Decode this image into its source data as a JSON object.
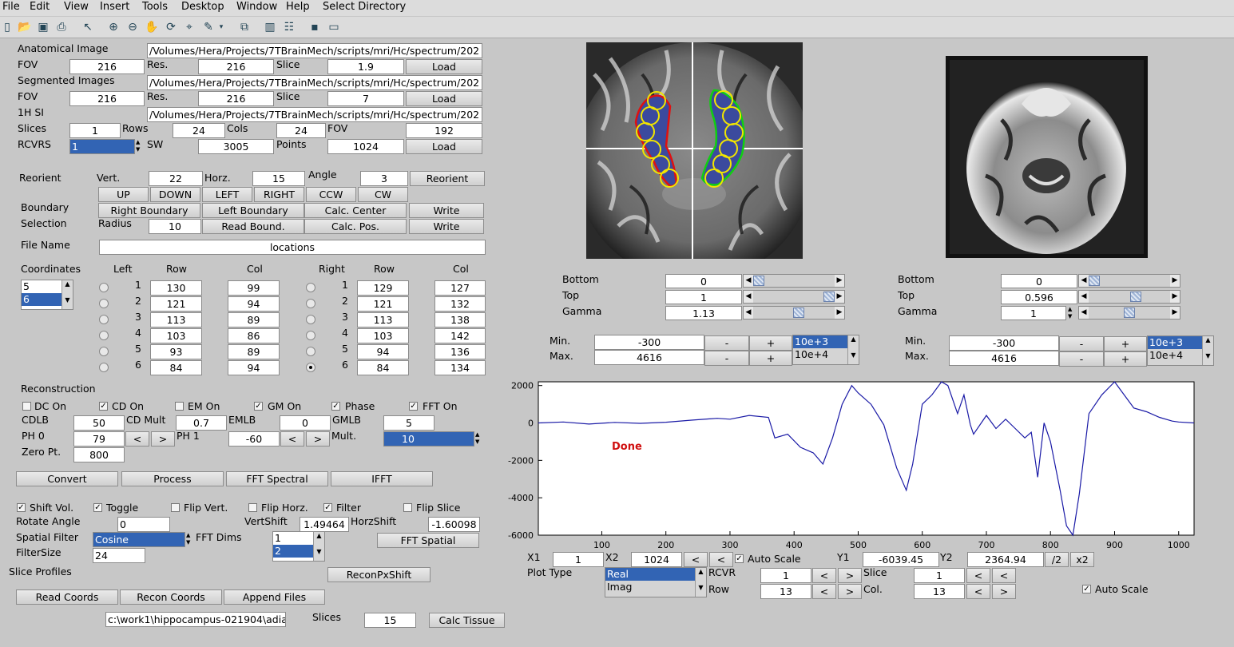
{
  "menu": [
    "File",
    "Edit",
    "View",
    "Insert",
    "Tools",
    "Desktop",
    "Window",
    "Help",
    "Select Directory"
  ],
  "toolbar_icons": [
    "new-file-icon",
    "open-folder-icon",
    "save-icon",
    "print-icon",
    "pointer-icon",
    "zoom-in-icon",
    "zoom-out-icon",
    "pan-hand-icon",
    "rotate-icon",
    "data-cursor-icon",
    "brush-icon",
    "dropdown-icon",
    "link-plot-icon",
    "colorbar-icon",
    "legend-icon",
    "hide-plot-tools-icon",
    "show-plot-tools-icon"
  ],
  "files": {
    "anat_label": "Anatomical Image",
    "anat_path": "/Volumes/Hera/Projects/7TBrainMech/scripts/mri/Hc/spectrum/202",
    "fov_label": "FOV",
    "fov1": "216",
    "res_label": "Res.",
    "res1": "216",
    "slice_label": "Slice",
    "slice1": "1.9",
    "load": "Load",
    "seg_label": "Segmented Images",
    "seg_path": "/Volumes/Hera/Projects/7TBrainMech/scripts/mri/Hc/spectrum/202",
    "fov2": "216",
    "res2": "216",
    "slice2": "7",
    "si_label": "1H SI",
    "si_path": "/Volumes/Hera/Projects/7TBrainMech/scripts/mri/Hc/spectrum/202",
    "slices_label": "Slices",
    "slices": "1",
    "rows_label": "Rows",
    "rows": "24",
    "cols_label": "Cols",
    "cols": "24",
    "fov3": "192",
    "rcvrs_label": "RCVRS",
    "rcvrs": "1",
    "sw_label": "SW",
    "sw": "3005",
    "points_label": "Points",
    "points": "1024"
  },
  "reorient": {
    "label": "Reorient",
    "vert_label": "Vert.",
    "vert": "22",
    "horz_label": "Horz.",
    "horz": "15",
    "angle_label": "Angle",
    "angle": "3",
    "button": "Reorient",
    "up": "UP",
    "down": "DOWN",
    "left": "LEFT",
    "right": "RIGHT",
    "ccw": "CCW",
    "cw": "CW",
    "boundary_label": "Boundary",
    "right_boundary": "Right Boundary",
    "left_boundary": "Left Boundary",
    "calc_center": "Calc. Center",
    "write": "Write",
    "selection_label": "Selection",
    "radius_label": "Radius",
    "radius": "10",
    "read_bound": "Read Bound.",
    "calc_pos": "Calc. Pos.",
    "file_name_label": "File Name",
    "file_name": "locations"
  },
  "coords": {
    "label": "Coordinates",
    "list": [
      "5",
      "6"
    ],
    "left_label": "Left",
    "right_label": "Right",
    "row_label": "Row",
    "col_label": "Col",
    "idx": [
      "1",
      "2",
      "3",
      "4",
      "5",
      "6"
    ],
    "left_rows": [
      "130",
      "121",
      "113",
      "103",
      "93",
      "84"
    ],
    "left_cols": [
      "99",
      "94",
      "89",
      "86",
      "89",
      "94"
    ],
    "right_rows": [
      "129",
      "121",
      "113",
      "103",
      "94",
      "84"
    ],
    "right_cols": [
      "127",
      "132",
      "138",
      "142",
      "136",
      "134"
    ]
  },
  "recon": {
    "label": "Reconstruction",
    "dc": "DC On",
    "cd": "CD On",
    "em": "EM On",
    "gm": "GM On",
    "phase": "Phase",
    "fft": "FFT On",
    "cdlb_label": "CDLB",
    "cdlb": "50",
    "cdmult_label": "CD Mult",
    "cdmult": "0.7",
    "emlb_label": "EMLB",
    "emlb": "0",
    "gmlb_label": "GMLB",
    "gmlb": "5",
    "ph0_label": "PH 0",
    "ph0": "79",
    "ph1_label": "PH 1",
    "ph1": "-60",
    "mult_label": "Mult.",
    "mult": "10",
    "zero_label": "Zero Pt.",
    "zero": "800",
    "lt": "<",
    "gt": ">",
    "convert": "Convert",
    "process": "Process",
    "fft_spectral": "FFT Spectral",
    "ifft": "IFFT"
  },
  "shift": {
    "shift_vol": "Shift Vol.",
    "toggle": "Toggle",
    "flip_vert": "Flip Vert.",
    "flip_horz": "Flip Horz.",
    "filter": "Filter",
    "flip_slice": "Flip Slice",
    "rotate_label": "Rotate Angle",
    "rotate": "0",
    "vshift_label": "VertShift",
    "vshift": "1.49464",
    "hshift_label": "HorzShift",
    "hshift": "-1.60098",
    "spatial_label": "Spatial Filter",
    "spatial": "Cosine",
    "fftdims_label": "FFT Dims",
    "fftdims": [
      "1",
      "2"
    ],
    "fft_spatial": "FFT Spatial",
    "filtersize_label": "FilterSize",
    "filtersize": "24",
    "slice_profiles": "Slice Profiles",
    "recon_px_shift": "ReconPxShift",
    "read_coords": "Read Coords",
    "recon_coords": "Recon Coords",
    "append_files": "Append Files",
    "path": "c:\\work1\\hippocampus-021904\\adia",
    "slices_label": "Slices",
    "slices": "15",
    "calc_tissue": "Calc Tissue"
  },
  "display1": {
    "bottom_label": "Bottom",
    "bottom": "0",
    "top_label": "Top",
    "top": "1",
    "gamma_label": "Gamma",
    "gamma": "1.13",
    "min_label": "Min.",
    "min": "-300",
    "max_label": "Max.",
    "max": "4616",
    "minus": "-",
    "plus": "+",
    "scale_opts": [
      "10e+3",
      "10e+4"
    ],
    "bottom_level": 0.0,
    "top_level": 1.0,
    "gamma_level": 0.57
  },
  "display2": {
    "bottom_label": "Bottom",
    "bottom": "0",
    "top_label": "Top",
    "top": "0.596",
    "gamma_label": "Gamma",
    "gamma": "1",
    "min_label": "Min.",
    "min": "-300",
    "max_label": "Max.",
    "max": "4616",
    "minus": "-",
    "plus": "+",
    "scale_opts": [
      "10e+3",
      "10e+4"
    ],
    "bottom_level": 0.0,
    "top_level": 0.596,
    "gamma_level": 0.5
  },
  "plot": {
    "status": "Done",
    "status_color": "#d01010",
    "line_color": "#1a1aa6",
    "x1_label": "X1",
    "x1": "1",
    "x2_label": "X2",
    "x2": "1024",
    "lt": "<",
    "auto_scale": "Auto Scale",
    "y1_label": "Y1",
    "y1": "-6039.45",
    "y2_label": "Y2",
    "y2": "2364.94",
    "half": "/2",
    "double": "x2",
    "plot_type_label": "Plot Type",
    "plot_types": [
      "Real",
      "Imag"
    ],
    "rcvr_label": "RCVR",
    "rcvr": "1",
    "row_label": "Row",
    "row": "13",
    "slice_label": "Slice",
    "slice": "1",
    "col_label": "Col.",
    "col": "13",
    "gt": ">",
    "auto_scale2": "Auto Scale"
  },
  "chart_data": {
    "type": "line",
    "xlim": [
      1,
      1024
    ],
    "ylim": [
      -6000,
      2200
    ],
    "xticks": [
      "100",
      "200",
      "300",
      "400",
      "500",
      "600",
      "700",
      "800",
      "900",
      "1000"
    ],
    "yticks": [
      "2000",
      "0",
      "-2000",
      "-4000",
      "-6000"
    ],
    "x": [
      1,
      40,
      80,
      120,
      160,
      200,
      240,
      280,
      300,
      330,
      360,
      370,
      390,
      410,
      430,
      445,
      460,
      475,
      490,
      500,
      520,
      540,
      560,
      575,
      585,
      600,
      615,
      630,
      640,
      655,
      665,
      675,
      680,
      700,
      715,
      730,
      745,
      760,
      770,
      780,
      790,
      800,
      815,
      825,
      835,
      845,
      860,
      880,
      900,
      915,
      930,
      950,
      970,
      990,
      1000,
      1024
    ],
    "y": [
      0,
      50,
      -60,
      30,
      -20,
      40,
      150,
      250,
      200,
      400,
      300,
      -800,
      -600,
      -1300,
      -1600,
      -2200,
      -800,
      1000,
      2000,
      1600,
      1000,
      -100,
      -2400,
      -3600,
      -2200,
      1000,
      1500,
      2200,
      2000,
      500,
      1500,
      -100,
      -600,
      400,
      -300,
      200,
      -300,
      -800,
      -500,
      -2900,
      0,
      -1000,
      -3600,
      -5500,
      -6000,
      -3800,
      500,
      1500,
      2200,
      1500,
      800,
      600,
      300,
      100,
      50,
      0
    ],
    "xlabel": "",
    "ylabel": "",
    "title": "",
    "grid": false
  }
}
